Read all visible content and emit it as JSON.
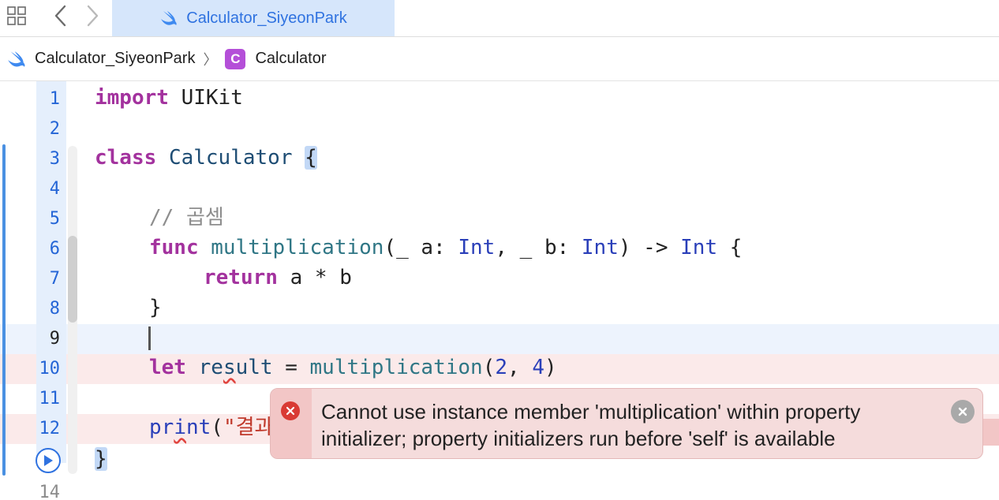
{
  "tabbar": {
    "active_tab_label": "Calculator_SiyeonPark"
  },
  "breadcrumb": {
    "project": "Calculator_SiyeonPark",
    "separator": "〉",
    "class_badge": "C",
    "file": "Calculator"
  },
  "editor": {
    "line_numbers": [
      "1",
      "2",
      "3",
      "4",
      "5",
      "6",
      "7",
      "8",
      "9",
      "10",
      "11",
      "12",
      "14"
    ],
    "lines": {
      "l1": {
        "kw": "import",
        "rest": " UIKit"
      },
      "l3": {
        "kw": "class",
        "name": "Calculator",
        "brace": "{"
      },
      "l5": {
        "comment": "// 곱셈"
      },
      "l6": {
        "kw": "func",
        "fn": "multiplication",
        "p1": "(_ a: ",
        "t1": "Int",
        "p2": ", _ b: ",
        "t2": "Int",
        "p3": ") -> ",
        "t3": "Int",
        "p4": " {"
      },
      "l7": {
        "kw": "return",
        "rest": " a * b"
      },
      "l8": {
        "text": "}"
      },
      "l10": {
        "kw": "let",
        "v1": "re",
        "v2": "s",
        "v3": "ult",
        "eq": " = ",
        "fn": "multiplication",
        "a1": "(",
        "n1": "2",
        "a2": ", ",
        "n2": "4",
        "a3": ")"
      },
      "l12": {
        "f1": "pr",
        "f2": "i",
        "f3": "nt",
        "open": "(",
        "str": "\"결과"
      },
      "l13": {
        "text": "}"
      }
    },
    "error": {
      "message": "Cannot use instance member 'multiplication' within property initializer; property initializers run before 'self' is available"
    }
  },
  "colors": {
    "keyword": "#a3329e",
    "type": "#2a3fb9",
    "function": "#2f7685",
    "accent": "#2f72e0",
    "error": "#d93a34"
  },
  "icons": [
    "grid-icon",
    "chevron-left-icon",
    "chevron-right-icon",
    "swift-icon",
    "class-c-icon",
    "run-icon",
    "error-icon",
    "close-icon"
  ]
}
